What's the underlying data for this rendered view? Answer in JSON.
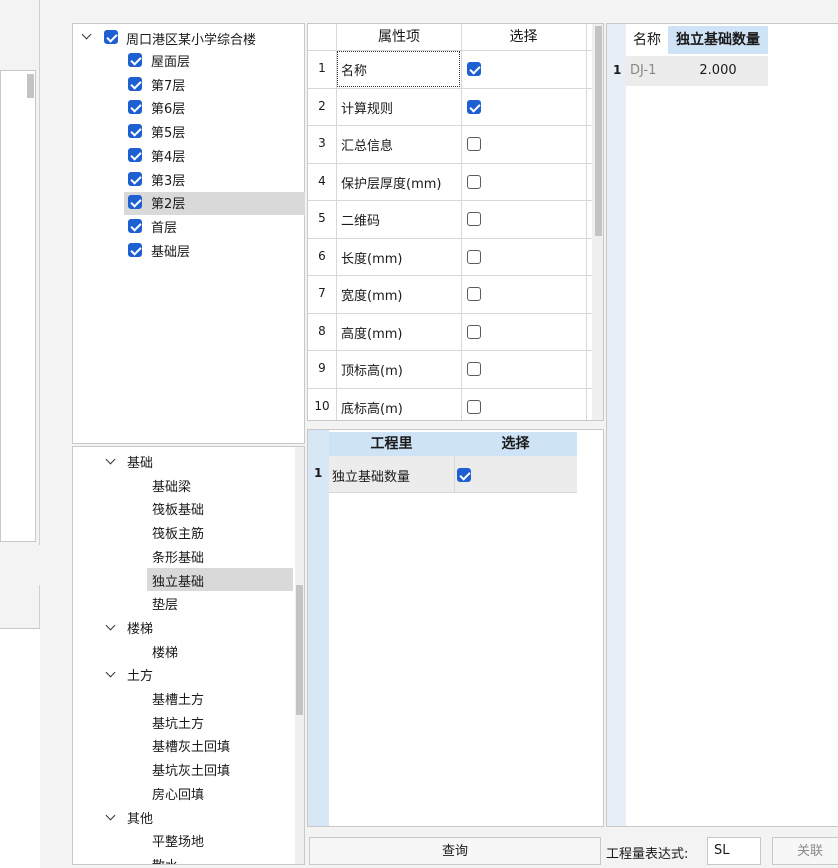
{
  "floor_tree": {
    "root": {
      "label": "周口港区某小学综合楼",
      "checked": true
    },
    "items": [
      {
        "label": "屋面层",
        "checked": true
      },
      {
        "label": "第7层",
        "checked": true
      },
      {
        "label": "第6层",
        "checked": true
      },
      {
        "label": "第5层",
        "checked": true
      },
      {
        "label": "第4层",
        "checked": true
      },
      {
        "label": "第3层",
        "checked": true
      },
      {
        "label": "第2层",
        "checked": true,
        "selected": true
      },
      {
        "label": "首层",
        "checked": true
      },
      {
        "label": "基础层",
        "checked": true
      }
    ]
  },
  "component_tree": {
    "groups": [
      {
        "label": "基础",
        "children": [
          "基础梁",
          "筏板基础",
          "筏板主筋",
          "条形基础",
          "独立基础",
          "垫层"
        ],
        "selected_child": "独立基础"
      },
      {
        "label": "楼梯",
        "children": [
          "楼梯"
        ]
      },
      {
        "label": "土方",
        "children": [
          "基槽土方",
          "基坑土方",
          "基槽灰土回填",
          "基坑灰土回填",
          "房心回填"
        ]
      },
      {
        "label": "其他",
        "children": [
          "平整场地",
          "散水"
        ]
      }
    ]
  },
  "attribute_table": {
    "headers": {
      "name": "属性项",
      "select": "选择"
    },
    "rows": [
      {
        "num": "1",
        "name": "名称",
        "checked": true
      },
      {
        "num": "2",
        "name": "计算规则",
        "checked": true
      },
      {
        "num": "3",
        "name": "汇总信息",
        "checked": false
      },
      {
        "num": "4",
        "name": "保护层厚度(mm)",
        "checked": false
      },
      {
        "num": "5",
        "name": "二维码",
        "checked": false
      },
      {
        "num": "6",
        "name": "长度(mm)",
        "checked": false
      },
      {
        "num": "7",
        "name": "宽度(mm)",
        "checked": false
      },
      {
        "num": "8",
        "name": "高度(mm)",
        "checked": false
      },
      {
        "num": "9",
        "name": "顶标高(m)",
        "checked": false
      },
      {
        "num": "10",
        "name": "底标高(m)",
        "checked": false
      }
    ]
  },
  "quantity_table": {
    "headers": {
      "name": "工程里",
      "select": "选择"
    },
    "rows": [
      {
        "num": "1",
        "name": "独立基础数量",
        "checked": true
      }
    ]
  },
  "result_table": {
    "headers": {
      "name": "名称",
      "value": "独立基础数量"
    },
    "rows": [
      {
        "num": "1",
        "name": "DJ-1",
        "value": "2.000"
      }
    ]
  },
  "bottom_bar": {
    "query_label": "查询",
    "expr_label": "工程量表达式:",
    "expr_value": "SL",
    "link_label": "关联"
  }
}
